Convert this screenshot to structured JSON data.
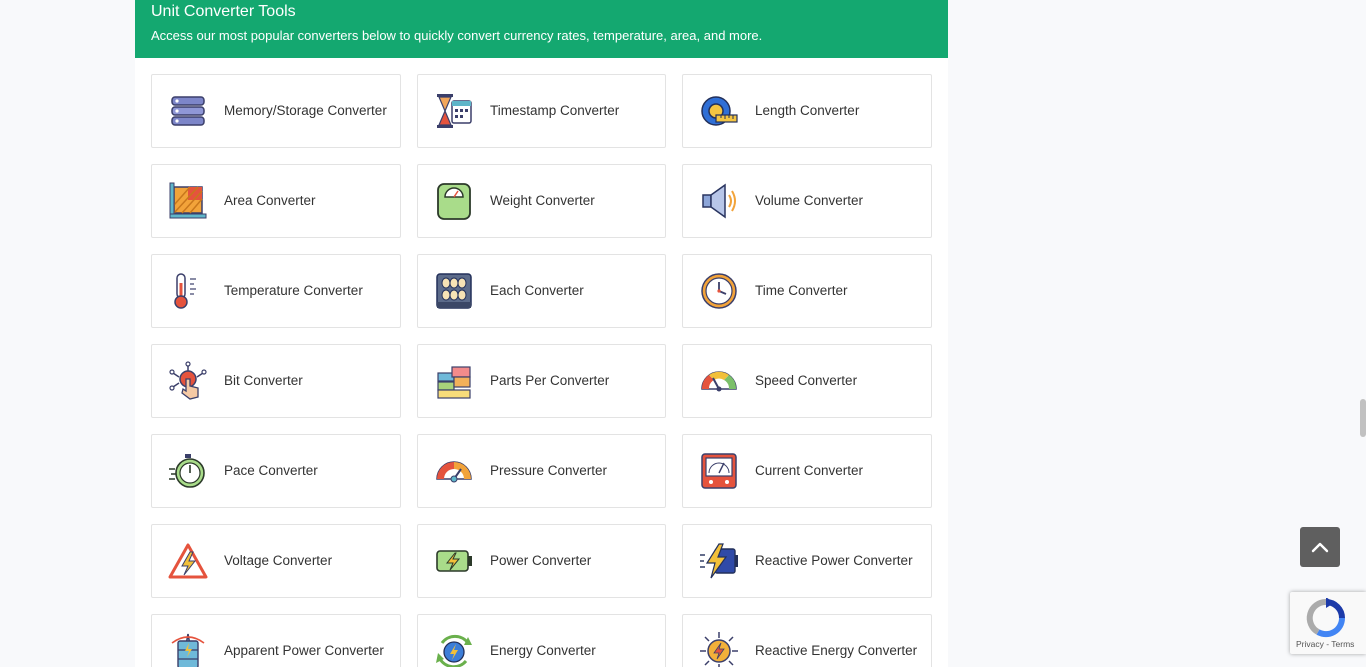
{
  "header": {
    "title": "Unit Converter Tools",
    "subtitle": "Access our most popular converters below to quickly convert currency rates, temperature, area, and more."
  },
  "tools": [
    {
      "label": "Memory/Storage Converter",
      "icon": "server-stack-icon"
    },
    {
      "label": "Timestamp Converter",
      "icon": "hourglass-calendar-icon"
    },
    {
      "label": "Length Converter",
      "icon": "tape-measure-icon"
    },
    {
      "label": "Area Converter",
      "icon": "area-square-ruler-icon"
    },
    {
      "label": "Weight Converter",
      "icon": "weighing-scale-icon"
    },
    {
      "label": "Volume Converter",
      "icon": "speaker-volume-icon"
    },
    {
      "label": "Temperature Converter",
      "icon": "thermometer-icon"
    },
    {
      "label": "Each Converter",
      "icon": "egg-tray-icon"
    },
    {
      "label": "Time Converter",
      "icon": "clock-icon"
    },
    {
      "label": "Bit Converter",
      "icon": "touch-circuit-icon"
    },
    {
      "label": "Parts Per Converter",
      "icon": "building-blocks-icon"
    },
    {
      "label": "Speed Converter",
      "icon": "speedometer-icon"
    },
    {
      "label": "Pace Converter",
      "icon": "stopwatch-icon"
    },
    {
      "label": "Pressure Converter",
      "icon": "pressure-gauge-icon"
    },
    {
      "label": "Current Converter",
      "icon": "ammeter-icon"
    },
    {
      "label": "Voltage Converter",
      "icon": "high-voltage-warning-icon"
    },
    {
      "label": "Power Converter",
      "icon": "battery-charging-icon"
    },
    {
      "label": "Reactive Power Converter",
      "icon": "lightning-battery-icon"
    },
    {
      "label": "Apparent Power Converter",
      "icon": "power-tower-icon"
    },
    {
      "label": "Energy Converter",
      "icon": "renewable-energy-icon"
    },
    {
      "label": "Reactive Energy Converter",
      "icon": "energy-burst-icon"
    }
  ],
  "recaptcha": {
    "privacy": "Privacy",
    "separator": " - ",
    "terms": "Terms"
  },
  "colors": {
    "header_bg": "#14a870",
    "page_bg": "#f8f9fb",
    "card_border": "#e3e3e3",
    "scroll_top_bg": "#5f5f5f"
  }
}
